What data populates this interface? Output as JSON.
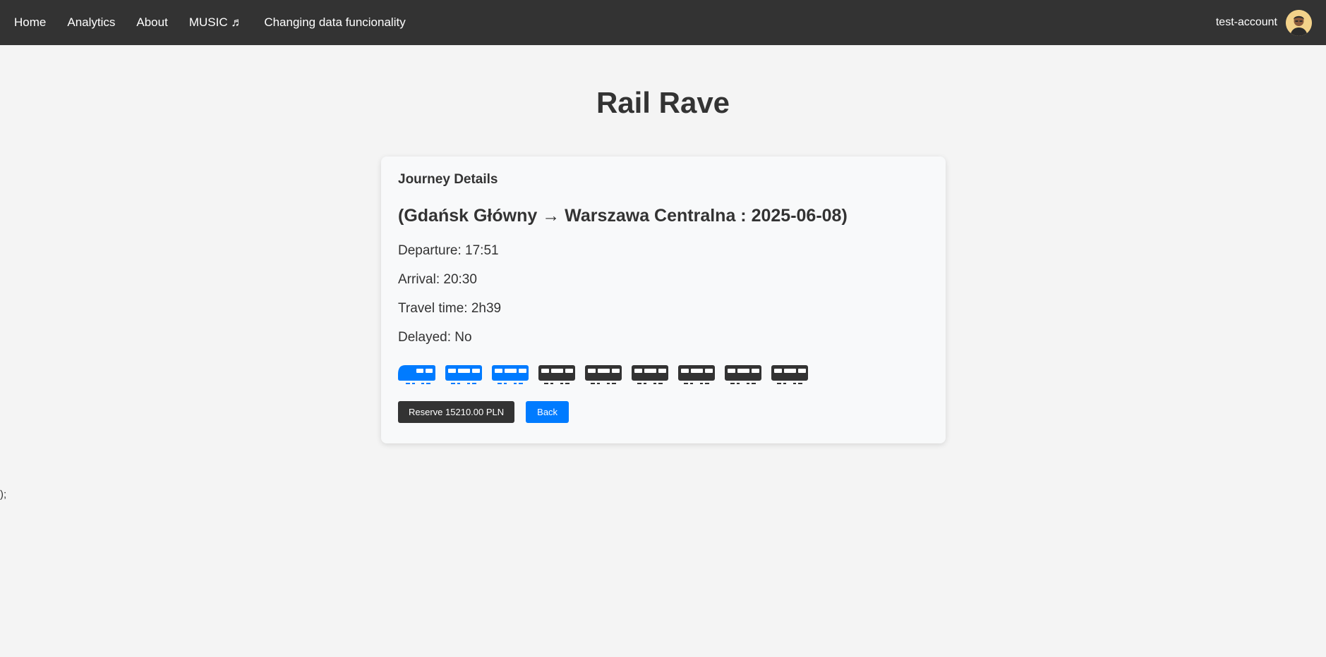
{
  "nav": {
    "links": [
      "Home",
      "Analytics",
      "About",
      "MUSIC ♬",
      "Changing data funcionality"
    ],
    "account_name": "test-account",
    "avatar_icon": "user-avatar"
  },
  "page": {
    "title": "Rail Rave"
  },
  "journey": {
    "heading": "Journey Details",
    "route": "(Gdańsk Główny → Warszawa Centralna : 2025-06-08)",
    "departure": "Departure: 17:51",
    "arrival": "Arrival: 20:30",
    "travel_time": "Travel time: 2h39",
    "delayed": "Delayed: No"
  },
  "train": {
    "cars": [
      {
        "kind": "locomotive",
        "selected": true
      },
      {
        "kind": "carriage",
        "selected": true
      },
      {
        "kind": "carriage",
        "selected": true
      },
      {
        "kind": "carriage",
        "selected": false
      },
      {
        "kind": "carriage",
        "selected": false
      },
      {
        "kind": "carriage",
        "selected": false
      },
      {
        "kind": "carriage",
        "selected": false
      },
      {
        "kind": "carriage",
        "selected": false
      },
      {
        "kind": "carriage",
        "selected": false
      }
    ],
    "colors": {
      "selected": "#007bff",
      "unselected": "#333333"
    }
  },
  "actions": {
    "reserve_label": "Reserve 15210.00 PLN",
    "back_label": "Back"
  },
  "stray_text": ");"
}
